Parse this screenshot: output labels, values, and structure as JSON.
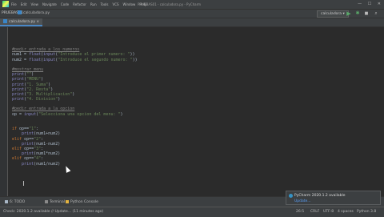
{
  "menu": {
    "items": [
      "File",
      "Edit",
      "View",
      "Navigate",
      "Code",
      "Refactor",
      "Run",
      "Tools",
      "VCS",
      "Window",
      "Help"
    ],
    "window_title": "PRUEBAS01 - calculadora.py - PyCharm",
    "controls": {
      "minimize": "—",
      "maximize": "☐",
      "close": "✕"
    }
  },
  "navbar": {
    "project": "PRUEBAS01",
    "file": "calculadora.py",
    "run_config": "calculadora",
    "run_icon": "play-icon",
    "debug_icon": "bug-icon",
    "search_icon": "search-icon"
  },
  "tab": {
    "label": "calculadora.py"
  },
  "code": [
    [],
    [
      {
        "t": "#pedir entrada a los numeros",
        "c": "cmt"
      }
    ],
    [
      {
        "t": "num1 = ",
        "c": ""
      },
      {
        "t": "float",
        "c": "fn"
      },
      {
        "t": "(",
        "c": ""
      },
      {
        "t": "input",
        "c": "fn"
      },
      {
        "t": "(",
        "c": ""
      },
      {
        "t": "\"Introduce el primer numero: \"",
        "c": "str"
      },
      {
        "t": "))",
        "c": ""
      }
    ],
    [
      {
        "t": "num2 = ",
        "c": ""
      },
      {
        "t": "float",
        "c": "fn"
      },
      {
        "t": "(",
        "c": ""
      },
      {
        "t": "input",
        "c": "fn"
      },
      {
        "t": "(",
        "c": ""
      },
      {
        "t": "\"Introduce el segundo numero: \"",
        "c": "str"
      },
      {
        "t": "))",
        "c": ""
      }
    ],
    [],
    [
      {
        "t": "#mostrar menu",
        "c": "cmt"
      }
    ],
    [
      {
        "t": "print",
        "c": "fn"
      },
      {
        "t": "(",
        "c": ""
      },
      {
        "t": "\"\"",
        "c": "str"
      },
      {
        "t": ")",
        "c": ""
      }
    ],
    [
      {
        "t": "print",
        "c": "fn"
      },
      {
        "t": "(",
        "c": ""
      },
      {
        "t": "\"MENU\"",
        "c": "str"
      },
      {
        "t": ")",
        "c": ""
      }
    ],
    [
      {
        "t": "print",
        "c": "fn"
      },
      {
        "t": "(",
        "c": ""
      },
      {
        "t": "\"1. Suma\"",
        "c": "str"
      },
      {
        "t": ")",
        "c": ""
      }
    ],
    [
      {
        "t": "print",
        "c": "fn"
      },
      {
        "t": "(",
        "c": ""
      },
      {
        "t": "\"2. Resta\"",
        "c": "str"
      },
      {
        "t": ")",
        "c": ""
      }
    ],
    [
      {
        "t": "print",
        "c": "fn"
      },
      {
        "t": "(",
        "c": ""
      },
      {
        "t": "\"3. Multiplicacion\"",
        "c": "str"
      },
      {
        "t": ")",
        "c": ""
      }
    ],
    [
      {
        "t": "print",
        "c": "fn"
      },
      {
        "t": "(",
        "c": ""
      },
      {
        "t": "\"4. Division\"",
        "c": "str"
      },
      {
        "t": ")",
        "c": ""
      }
    ],
    [],
    [
      {
        "t": "#pedir entrada a la opcion",
        "c": "cmt"
      }
    ],
    [
      {
        "t": "op = ",
        "c": ""
      },
      {
        "t": "input",
        "c": "fn"
      },
      {
        "t": "(",
        "c": ""
      },
      {
        "t": "\"Selecciona una opcion del menu: \"",
        "c": "str"
      },
      {
        "t": ")",
        "c": ""
      }
    ],
    [],
    [],
    [
      {
        "t": "if ",
        "c": "kw"
      },
      {
        "t": "op==",
        "c": ""
      },
      {
        "t": "\"1\"",
        "c": "str"
      },
      {
        "t": ":",
        "c": ""
      }
    ],
    [
      {
        "t": "    ",
        "c": ""
      },
      {
        "t": "print",
        "c": "fn"
      },
      {
        "t": "(num1+num2)",
        "c": ""
      }
    ],
    [
      {
        "t": "elif ",
        "c": "kw"
      },
      {
        "t": "op==",
        "c": ""
      },
      {
        "t": "\"2\"",
        "c": "str"
      },
      {
        "t": ":",
        "c": ""
      }
    ],
    [
      {
        "t": "    ",
        "c": ""
      },
      {
        "t": "print",
        "c": "fn"
      },
      {
        "t": "(num1-num2)",
        "c": ""
      }
    ],
    [
      {
        "t": "elif ",
        "c": "kw"
      },
      {
        "t": "op==",
        "c": ""
      },
      {
        "t": "\"3\"",
        "c": "str"
      },
      {
        "t": ":",
        "c": ""
      }
    ],
    [
      {
        "t": "    ",
        "c": ""
      },
      {
        "t": "print",
        "c": "fn"
      },
      {
        "t": "(num1*num2)",
        "c": ""
      }
    ],
    [
      {
        "t": "elif ",
        "c": "kw"
      },
      {
        "t": "op==",
        "c": ""
      },
      {
        "t": "\"4\"",
        "c": "str"
      },
      {
        "t": ":",
        "c": ""
      }
    ],
    [
      {
        "t": "    ",
        "c": ""
      },
      {
        "t": "print",
        "c": "fn"
      },
      {
        "t": "(num1/num2)",
        "c": ""
      }
    ],
    []
  ],
  "bottom_tools": [
    {
      "label": "6: TODO",
      "icon": "todo-icon",
      "color": "#a9b7c6"
    },
    {
      "label": "Terminal",
      "icon": "terminal-icon",
      "color": "#8a8a8a"
    },
    {
      "label": "Python Console",
      "icon": "python-console-icon",
      "color": "#e3b341"
    }
  ],
  "notification": {
    "title": "PyCharm 2020.1.2 available",
    "link": "Update..."
  },
  "status": {
    "message": "Check: 2020.1.2 available // Update... (11 minutes ago)",
    "position": "26:5",
    "line_ending": "CRLF",
    "encoding": "UTF-8",
    "indent": "4 spaces",
    "interpreter": "Python 3.8"
  }
}
